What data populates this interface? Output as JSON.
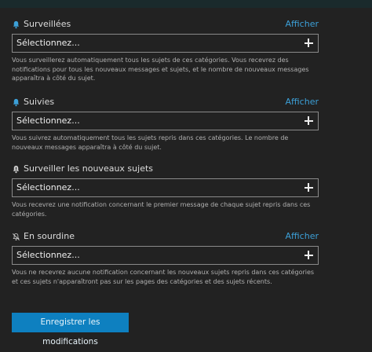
{
  "sections": [
    {
      "icon": "bell-icon",
      "title": "Surveillées",
      "link": "Afficher",
      "placeholder": "Sélectionnez...",
      "description": "Vous surveillerez automatiquement tous les sujets de ces catégories. Vous recevrez des notifications pour tous les nouveaux messages et sujets, et le nombre de nouveaux messages apparaîtra à côté du sujet."
    },
    {
      "icon": "bell-icon",
      "title": "Suivies",
      "link": "Afficher",
      "placeholder": "Sélectionnez...",
      "description": "Vous suivrez automatiquement tous les sujets repris dans ces catégories. Le nombre de nouveaux messages apparaîtra à côté du sujet."
    },
    {
      "icon": "bell-exclamation-icon",
      "title": "Surveiller les nouveaux sujets",
      "link": "",
      "placeholder": "Sélectionnez...",
      "description": "Vous recevrez une notification concernant le premier message de chaque sujet repris dans ces catégories."
    },
    {
      "icon": "bell-slash-icon",
      "title": "En sourdine",
      "link": "Afficher",
      "placeholder": "Sélectionnez...",
      "description": "Vous ne recevrez aucune notification concernant les nouveaux sujets repris dans ces catégories et ces sujets n'apparaîtront pas sur les pages des catégories et des sujets récents."
    }
  ],
  "save_button": "Enregistrer les modifications",
  "colors": {
    "background": "#222222",
    "accent": "#0e80c0",
    "link": "#3ca0d8",
    "topbar": "#1a2a2c"
  }
}
